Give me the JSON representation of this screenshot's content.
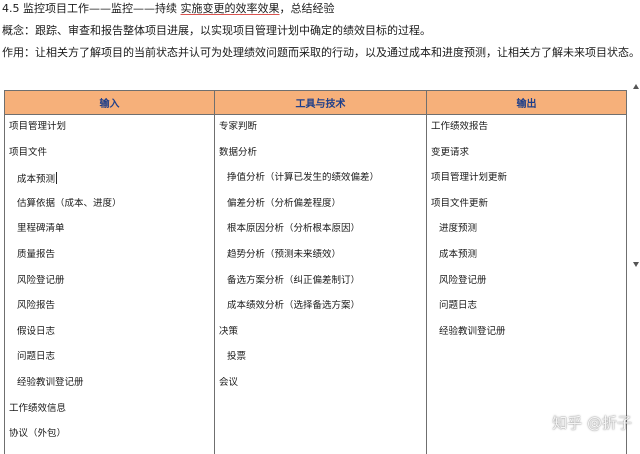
{
  "heading": {
    "prefix": "4.5 监控项目工作——监控——持续 ",
    "highlight": "实施变更的效率效果",
    "suffix": "，总结经验"
  },
  "concept": "概念：跟踪、审查和报告整体项目进展，以实现项目管理计划中确定的绩效目标的过程。",
  "purpose": "作用：让相关方了解项目的当前状态并认可为处理绩效问题而采取的行动，以及通过成本和进度预测，让相关方了解未来项目状态。",
  "table": {
    "headers": [
      "输入",
      "工具与技术",
      "输出"
    ],
    "inputs": [
      {
        "text": "项目管理计划",
        "level": 0
      },
      {
        "text": "项目文件",
        "level": 0
      },
      {
        "text": "成本预测",
        "level": 1
      },
      {
        "text": "估算依据（成本、进度）",
        "level": 1
      },
      {
        "text": "里程碑清单",
        "level": 1
      },
      {
        "text": "质量报告",
        "level": 1
      },
      {
        "text": "风险登记册",
        "level": 1
      },
      {
        "text": "风险报告",
        "level": 1
      },
      {
        "text": "假设日志",
        "level": 1
      },
      {
        "text": "问题日志",
        "level": 1
      },
      {
        "text": "经验教训登记册",
        "level": 1
      },
      {
        "text": "工作绩效信息",
        "level": 0
      },
      {
        "text": "协议（外包）",
        "level": 0
      }
    ],
    "tools": [
      {
        "text": "专家判断",
        "level": 0
      },
      {
        "text": "数据分析",
        "level": 0
      },
      {
        "text": "挣值分析（计算已发生的绩效偏差）",
        "level": 1
      },
      {
        "text": "偏差分析（分析偏差程度）",
        "level": 1
      },
      {
        "text": "根本原因分析（分析根本原因）",
        "level": 1
      },
      {
        "text": "趋势分析（预测未来绩效）",
        "level": 1
      },
      {
        "text": "备选方案分析（纠正偏差制订）",
        "level": 1
      },
      {
        "text": "成本绩效分析（选择备选方案）",
        "level": 1
      },
      {
        "text": "决策",
        "level": 0
      },
      {
        "text": "投票",
        "level": 1
      },
      {
        "text": "会议",
        "level": 0
      }
    ],
    "outputs": [
      {
        "text": "工作绩效报告",
        "level": 0
      },
      {
        "text": "变更请求",
        "level": 0
      },
      {
        "text": "项目管理计划更新",
        "level": 0
      },
      {
        "text": "项目文件更新",
        "level": 0
      },
      {
        "text": "进度预测",
        "level": 1
      },
      {
        "text": "成本预测",
        "level": 1
      },
      {
        "text": "风险登记册",
        "level": 1
      },
      {
        "text": "问题日志",
        "level": 1
      },
      {
        "text": "经验教训登记册",
        "level": 1
      }
    ]
  },
  "watermark": "知乎 @折子"
}
